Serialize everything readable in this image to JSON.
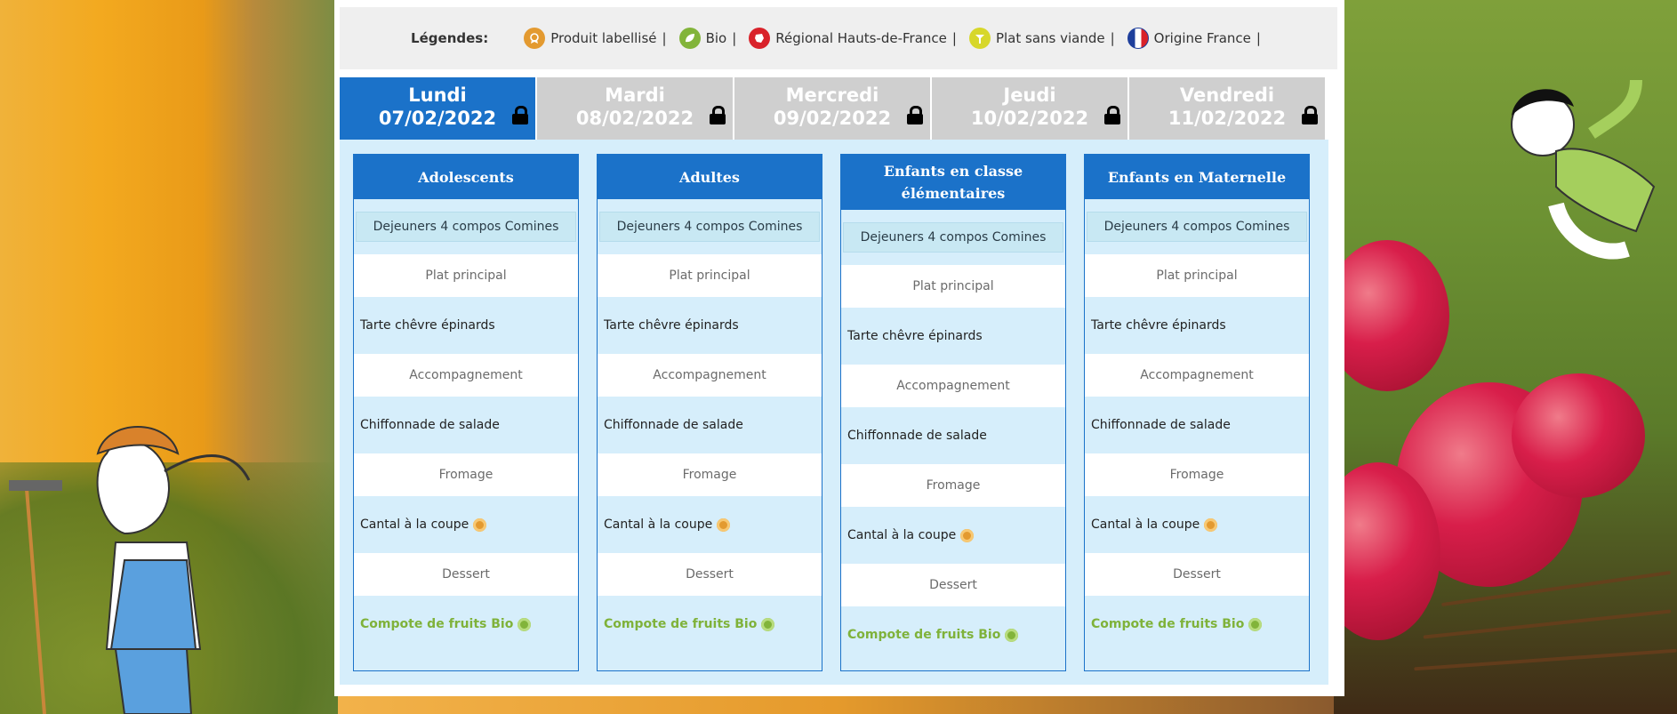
{
  "legend": {
    "title": "Légendes:",
    "items": [
      {
        "label": "Produit labellisé",
        "sep": "|",
        "icon": "medal-icon",
        "color": "#e39a30"
      },
      {
        "label": "Bio",
        "sep": "|",
        "icon": "bio-leaf-icon",
        "color": "#82b43a"
      },
      {
        "label": "Régional Hauts-de-France",
        "sep": "|",
        "icon": "region-icon",
        "color": "#d9222a"
      },
      {
        "label": "Plat sans viande",
        "sep": "|",
        "icon": "veggie-icon",
        "color": "#d7d72a"
      },
      {
        "label": "Origine France",
        "sep": "|",
        "icon": "france-flag-icon",
        "color": "#1e3f9c"
      }
    ]
  },
  "tabs": [
    {
      "day": "Lundi",
      "date": "07/02/2022",
      "active": true
    },
    {
      "day": "Mardi",
      "date": "08/02/2022",
      "active": false
    },
    {
      "day": "Mercredi",
      "date": "09/02/2022",
      "active": false
    },
    {
      "day": "Jeudi",
      "date": "10/02/2022",
      "active": false
    },
    {
      "day": "Vendredi",
      "date": "11/02/2022",
      "active": false
    }
  ],
  "columns": [
    {
      "title": "Adolescents",
      "subtitle": "Dejeuners 4 compos Comines",
      "sections": [
        {
          "label": "Plat principal",
          "dish": "Tarte chêvre épinards",
          "badge": ""
        },
        {
          "label": "Accompagnement",
          "dish": "Chiffonnade de salade",
          "badge": ""
        },
        {
          "label": "Fromage",
          "dish": "Cantal à la coupe",
          "badge": "label"
        },
        {
          "label": "Dessert",
          "dish": "Compote de fruits Bio",
          "badge": "bio"
        }
      ]
    },
    {
      "title": "Adultes",
      "subtitle": "Dejeuners 4 compos Comines",
      "sections": [
        {
          "label": "Plat principal",
          "dish": "Tarte chêvre épinards",
          "badge": ""
        },
        {
          "label": "Accompagnement",
          "dish": "Chiffonnade de salade",
          "badge": ""
        },
        {
          "label": "Fromage",
          "dish": "Cantal à la coupe",
          "badge": "label"
        },
        {
          "label": "Dessert",
          "dish": "Compote de fruits Bio",
          "badge": "bio"
        }
      ]
    },
    {
      "title": "Enfants en classe élémentaires",
      "subtitle": "Dejeuners 4 compos Comines",
      "sections": [
        {
          "label": "Plat principal",
          "dish": "Tarte chêvre épinards",
          "badge": ""
        },
        {
          "label": "Accompagnement",
          "dish": "Chiffonnade de salade",
          "badge": ""
        },
        {
          "label": "Fromage",
          "dish": "Cantal à la coupe",
          "badge": "label"
        },
        {
          "label": "Dessert",
          "dish": "Compote de fruits Bio",
          "badge": "bio"
        }
      ]
    },
    {
      "title": "Enfants en Maternelle",
      "subtitle": "Dejeuners 4 compos Comines",
      "sections": [
        {
          "label": "Plat principal",
          "dish": "Tarte chêvre épinards",
          "badge": ""
        },
        {
          "label": "Accompagnement",
          "dish": "Chiffonnade de salade",
          "badge": ""
        },
        {
          "label": "Fromage",
          "dish": "Cantal à la coupe",
          "badge": "label"
        },
        {
          "label": "Dessert",
          "dish": "Compote de fruits Bio",
          "badge": "bio"
        }
      ]
    }
  ],
  "colors": {
    "active_tab": "#1b72c9",
    "inactive_tab": "#cfcfcf",
    "bio_text": "#7fb23a",
    "content_bg": "#d6eefb"
  }
}
